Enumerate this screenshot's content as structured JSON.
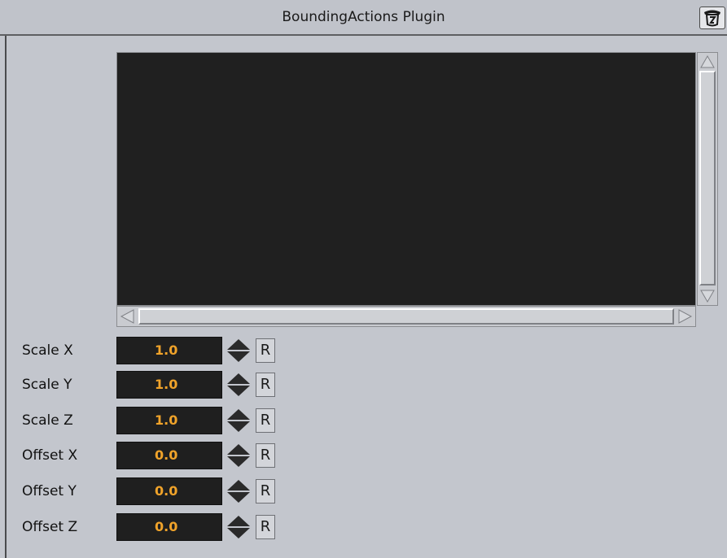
{
  "window": {
    "title": "BoundingActions Plugin",
    "icon": "plugin-info-icon"
  },
  "params": [
    {
      "label": "Scale X",
      "value": "1.0",
      "reset": "R"
    },
    {
      "label": "Scale Y",
      "value": "1.0",
      "reset": "R"
    },
    {
      "label": "Scale Z",
      "value": "1.0",
      "reset": "R"
    },
    {
      "label": "Offset X",
      "value": "0.0",
      "reset": "R"
    },
    {
      "label": "Offset Y",
      "value": "0.0",
      "reset": "R"
    },
    {
      "label": "Offset Z",
      "value": "0.0",
      "reset": "R"
    }
  ],
  "colors": {
    "background": "#c3c6cd",
    "field_background": "#1f1f1f",
    "value_text": "#f0a32a"
  }
}
